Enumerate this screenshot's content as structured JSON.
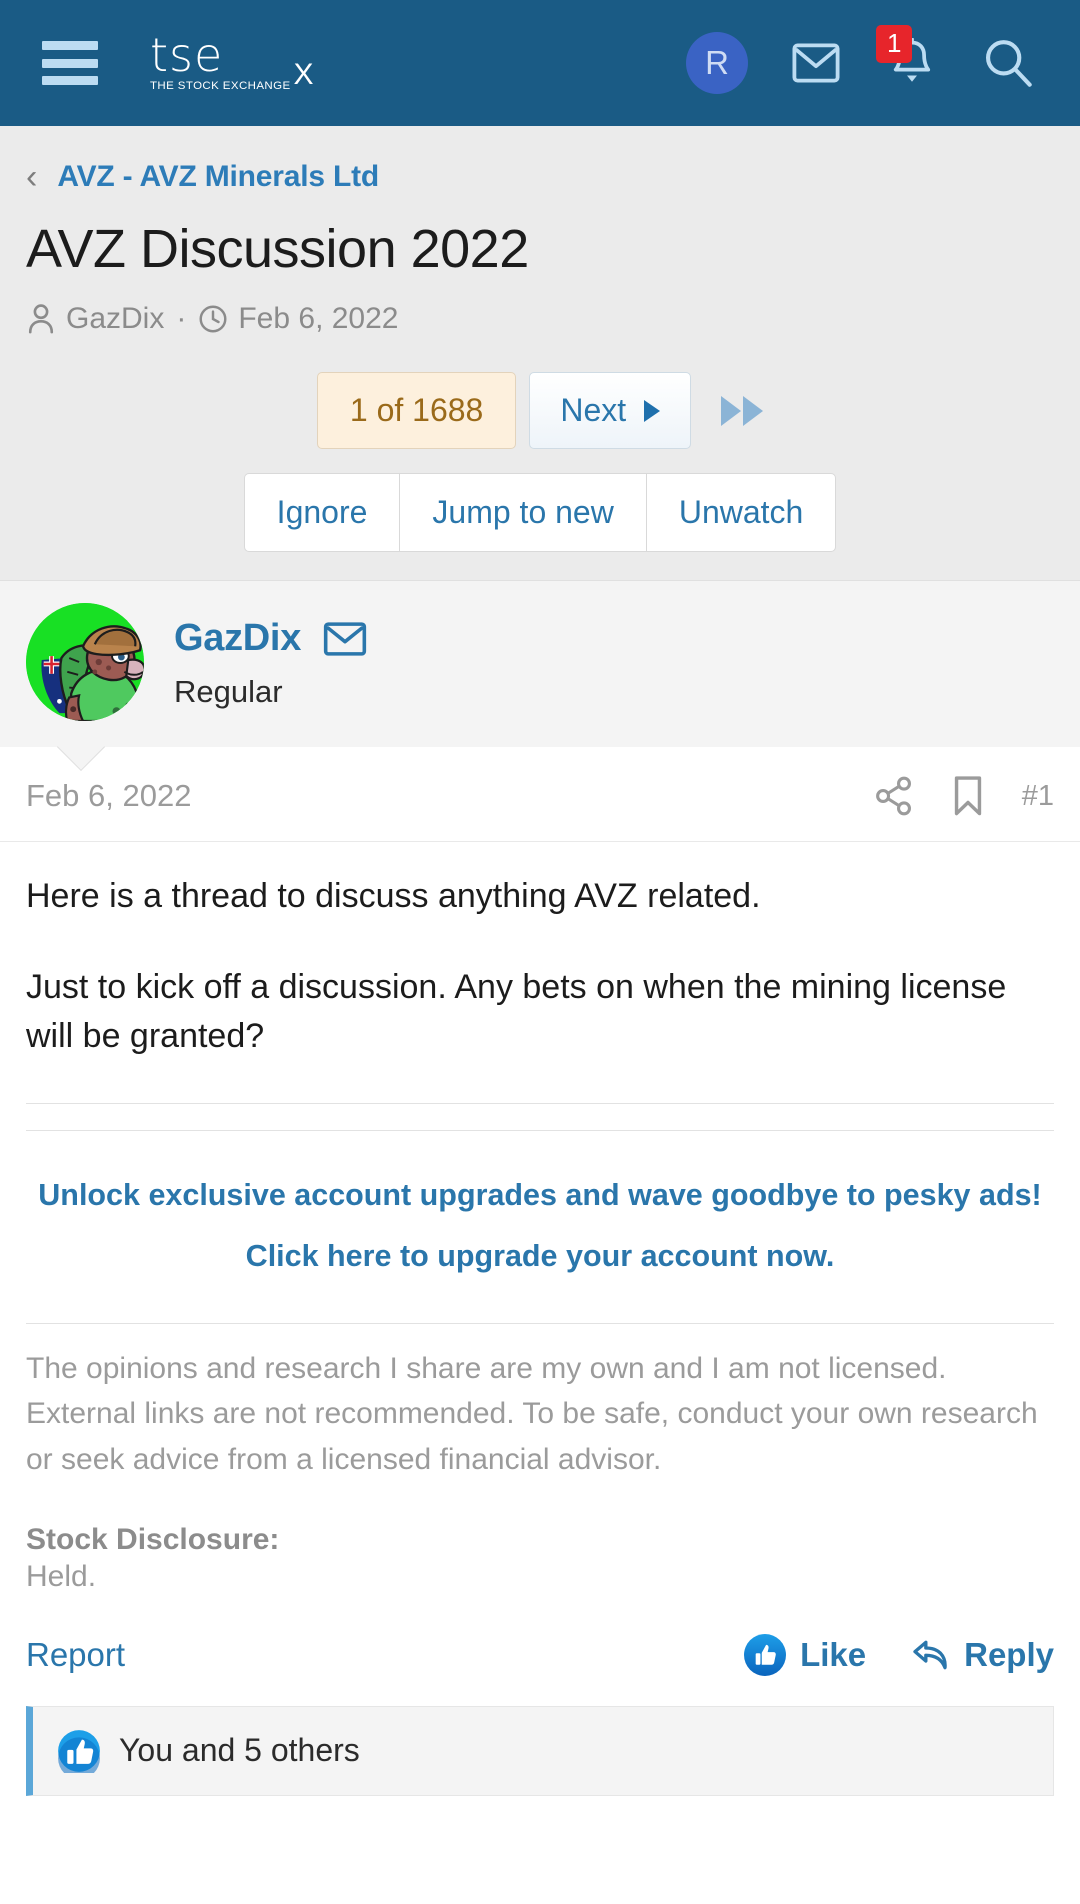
{
  "topbar": {
    "menu_icon": "hamburger-menu-icon",
    "logo_text": "tse",
    "logo_tagline": "THE STOCK EXCHANGE",
    "logo_mark": "X",
    "user_initial": "R",
    "mail_icon": "envelope-icon",
    "bell_icon": "bell-icon",
    "notification_count": "1",
    "search_icon": "search-icon"
  },
  "thread": {
    "back_icon": "chevron-left-icon",
    "breadcrumb": "AVZ - AVZ Minerals Ltd",
    "title": "AVZ Discussion 2022",
    "author": "GazDix",
    "meta_separator": "·",
    "date": "Feb 6, 2022"
  },
  "pager": {
    "count_label": "1 of 1688",
    "next_label": "Next",
    "next_icon": "triangle-right-icon",
    "fast_forward_icon": "fast-forward-icon",
    "buttons": [
      {
        "label": "Ignore"
      },
      {
        "label": "Jump to new"
      },
      {
        "label": "Unwatch"
      }
    ]
  },
  "poster": {
    "avatar_alt": "turtle-cowboy-avatar",
    "name": "GazDix",
    "message_icon": "envelope-icon",
    "rank": "Regular"
  },
  "post": {
    "date": "Feb 6, 2022",
    "share_icon": "share-icon",
    "bookmark_icon": "bookmark-icon",
    "number": "#1",
    "paragraphs": [
      "Here is a thread to discuss anything AVZ related.",
      "Just to kick off a discussion. Any bets on when the mining license will be granted?"
    ],
    "promo": "Unlock exclusive account upgrades and wave goodbye to pesky ads! Click here to upgrade your account now.",
    "disclaimer": "The opinions and research I share are my own and I am not licensed. External links are not recommended. To be safe, conduct your own research or seek advice from a licensed financial advisor.",
    "disclosure_label": "Stock Disclosure:",
    "disclosure_value": "Held.",
    "report_label": "Report",
    "like_label": "Like",
    "like_icon": "thumbs-up-icon",
    "reply_label": "Reply",
    "reply_icon": "reply-arrow-icon"
  },
  "likes": {
    "icon": "thumbs-up-icon",
    "text": "You and 5 others"
  },
  "colors": {
    "nav_bg": "#1a5b85",
    "link": "#2a76ab",
    "badge_red": "#e7252b",
    "pager_amber_bg": "#fdf0dd",
    "pager_amber_text": "#9a6a1a",
    "like_blue": "#0a64bd",
    "avatar_green": "#18e024"
  }
}
